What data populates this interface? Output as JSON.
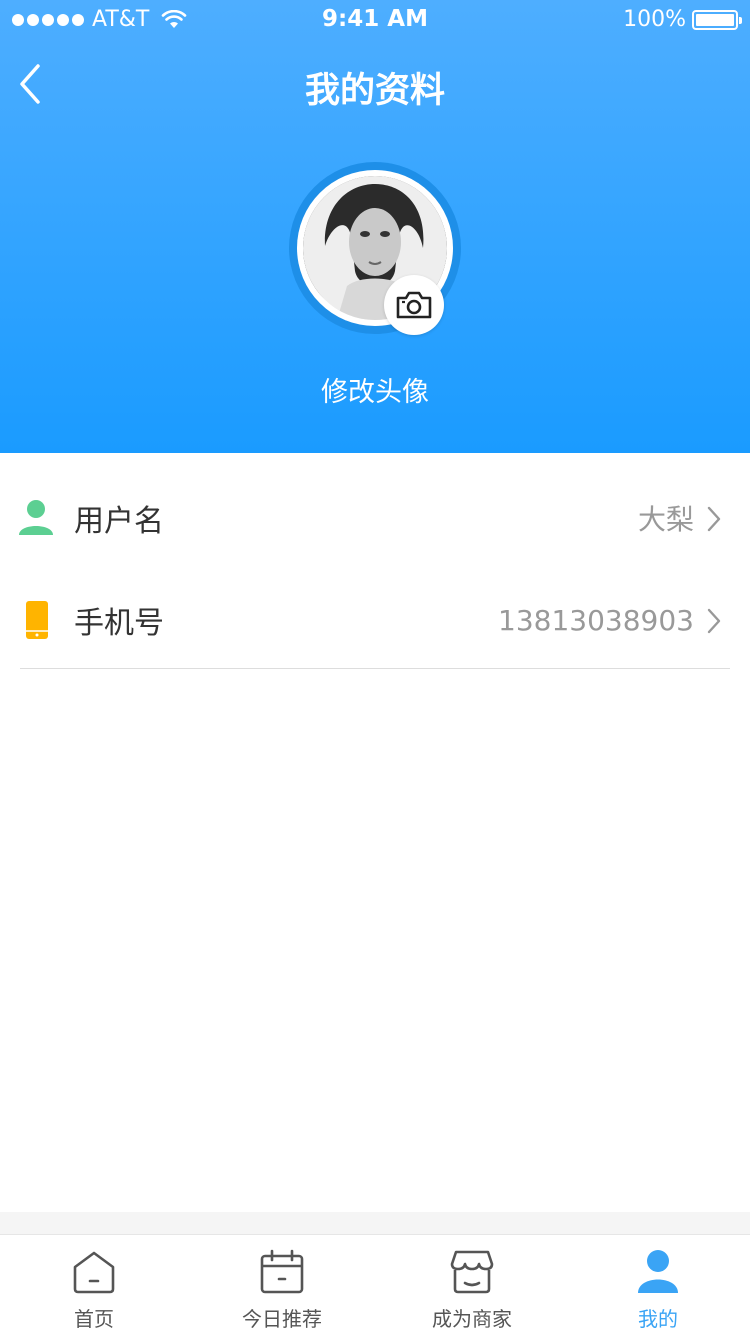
{
  "status_bar": {
    "carrier": "AT&T",
    "time": "9:41 AM",
    "battery": "100%"
  },
  "header": {
    "title": "我的资料",
    "change_avatar_label": "修改头像"
  },
  "profile_rows": [
    {
      "label": "用户名",
      "value": "大梨",
      "icon": "person-icon",
      "icon_color": "#5ccf92"
    },
    {
      "label": "手机号",
      "value": "13813038903",
      "icon": "phone-icon",
      "icon_color": "#ffb400"
    }
  ],
  "tabbar": {
    "tabs": [
      {
        "label": "首页",
        "icon": "home-icon",
        "active": false
      },
      {
        "label": "今日推荐",
        "icon": "calendar-icon",
        "active": false
      },
      {
        "label": "成为商家",
        "icon": "store-icon",
        "active": false
      },
      {
        "label": "我的",
        "icon": "user-icon",
        "active": true
      }
    ]
  },
  "colors": {
    "header_top": "#4eaeff",
    "header_bottom": "#1a9bff",
    "active_tab": "#3aa4f5"
  }
}
